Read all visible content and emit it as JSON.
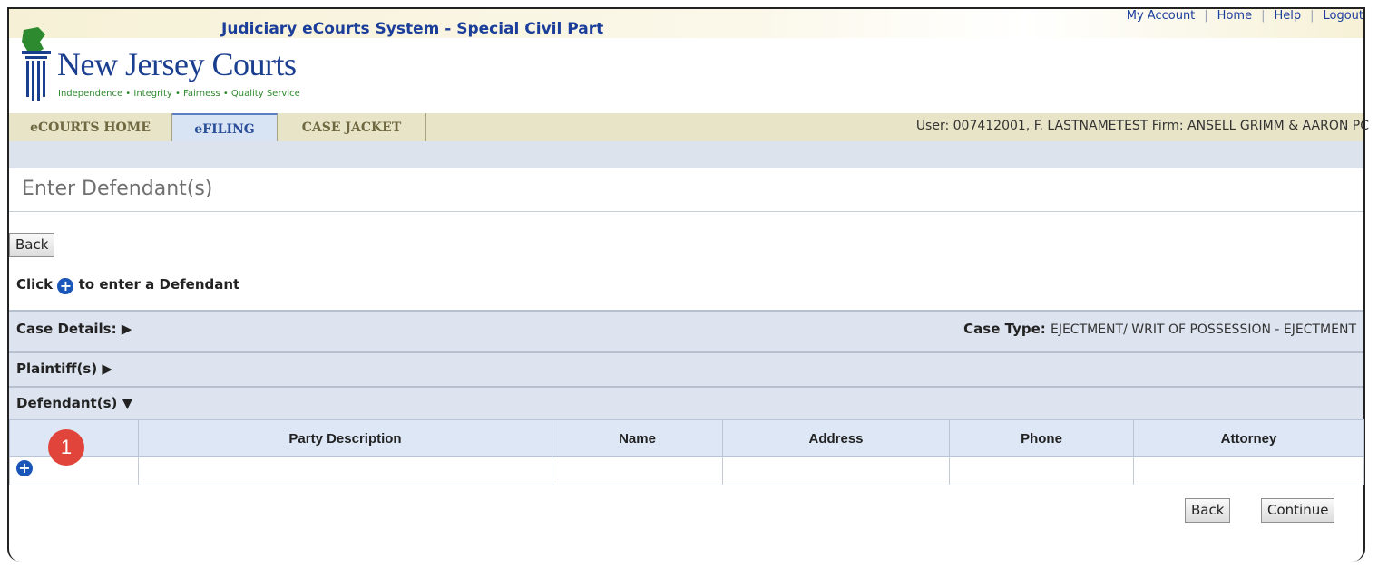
{
  "banner": {
    "title": "Judiciary eCourts System - Special Civil Part"
  },
  "toplinks": [
    "My Account",
    "Home",
    "Help",
    "Logout"
  ],
  "logo": {
    "name": "New Jersey Courts",
    "tagline": "Independence • Integrity • Fairness • Quality Service"
  },
  "tabs": [
    "eCOURTS HOME",
    "eFILING",
    "CASE JACKET"
  ],
  "user_info": "User: 007412001, F. LASTNAMETEST  Firm: ANSELL GRIMM & AARON PC",
  "page_title": "Enter Defendant(s)",
  "back_label": "Back",
  "hint": {
    "before": "Click",
    "after": "to enter a Defendant"
  },
  "sections": {
    "case_details": "Case Details: ▶",
    "case_type_label": "Case Type:",
    "case_type_value": "EJECTMENT/ WRIT OF POSSESSION - EJECTMENT",
    "plaintiffs": "Plaintiff(s) ▶",
    "defendants": "Defendant(s) ▼"
  },
  "table": {
    "columns": [
      "",
      "Party Description",
      "Name",
      "Address",
      "Phone",
      "Attorney"
    ]
  },
  "callout": "1",
  "footer": {
    "back_label": "Back",
    "continue_label": "Continue"
  },
  "colors": {
    "brand_blue": "#1a3e9a",
    "callout_red": "#e0443a",
    "add_icon_blue": "#1a55b8"
  },
  "icons": {
    "add": "plus-circle-icon",
    "logo": "courthouse-logo"
  }
}
